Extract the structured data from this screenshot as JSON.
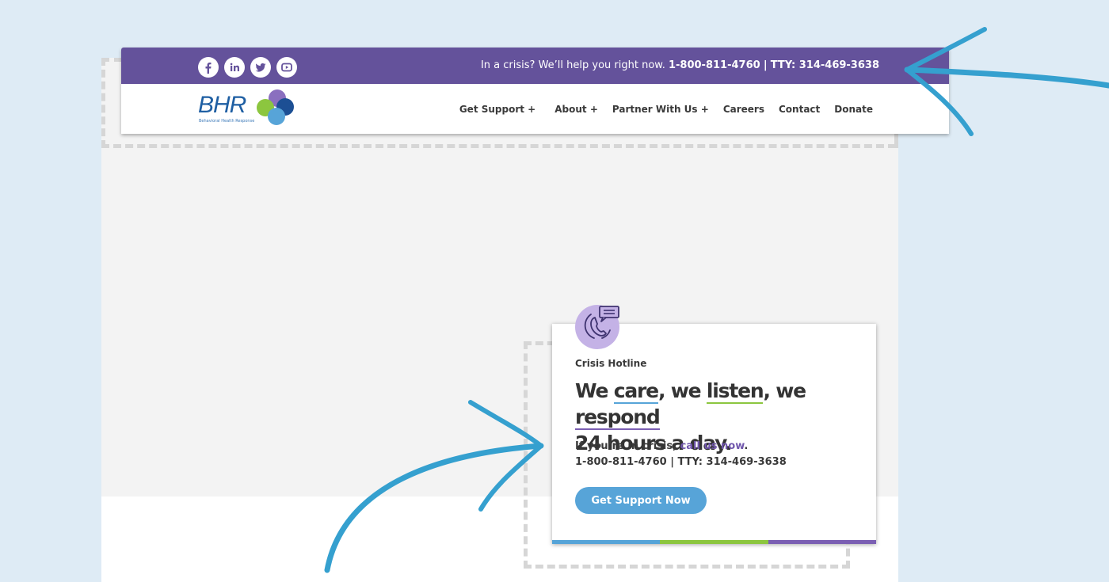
{
  "header": {
    "socials": [
      {
        "name": "facebook-icon"
      },
      {
        "name": "linkedin-icon"
      },
      {
        "name": "twitter-icon"
      },
      {
        "name": "youtube-icon"
      }
    ],
    "crisis_prefix": "In a crisis? We’ll help you right now.",
    "crisis_phone": "1-800-811-4760",
    "crisis_sep": "|",
    "crisis_tty": "TTY: 314-469-3638",
    "logo": {
      "text": "BHR",
      "subtitle": "Behavioral Health Response"
    },
    "nav": [
      {
        "label": "Get Support +"
      },
      {
        "label": "About +"
      },
      {
        "label": "Partner With Us +"
      },
      {
        "label": "Careers"
      },
      {
        "label": "Contact"
      },
      {
        "label": "Donate"
      }
    ]
  },
  "card": {
    "eyebrow": "Crisis Hotline",
    "headline": {
      "w1": "We ",
      "care": "care",
      "w2": ", we ",
      "listen": "listen",
      "w3": ", we ",
      "respond": "respond",
      "line2": "24 hours a day."
    },
    "body_prefix": "If you’re in crisis, ",
    "body_link": "call us now",
    "body_suffix": ".",
    "phone_line": "1-800-811-4760 | TTY: 314-469-3638",
    "cta_label": "Get Support Now",
    "bar_colors": [
      "#56a4d8",
      "#8cc63f",
      "#7b5fb3"
    ]
  },
  "colors": {
    "brand_purple": "#64529b",
    "accent_blue": "#57a4d8",
    "annotation_arrow": "#35a0cf",
    "background": "#deebf5"
  }
}
